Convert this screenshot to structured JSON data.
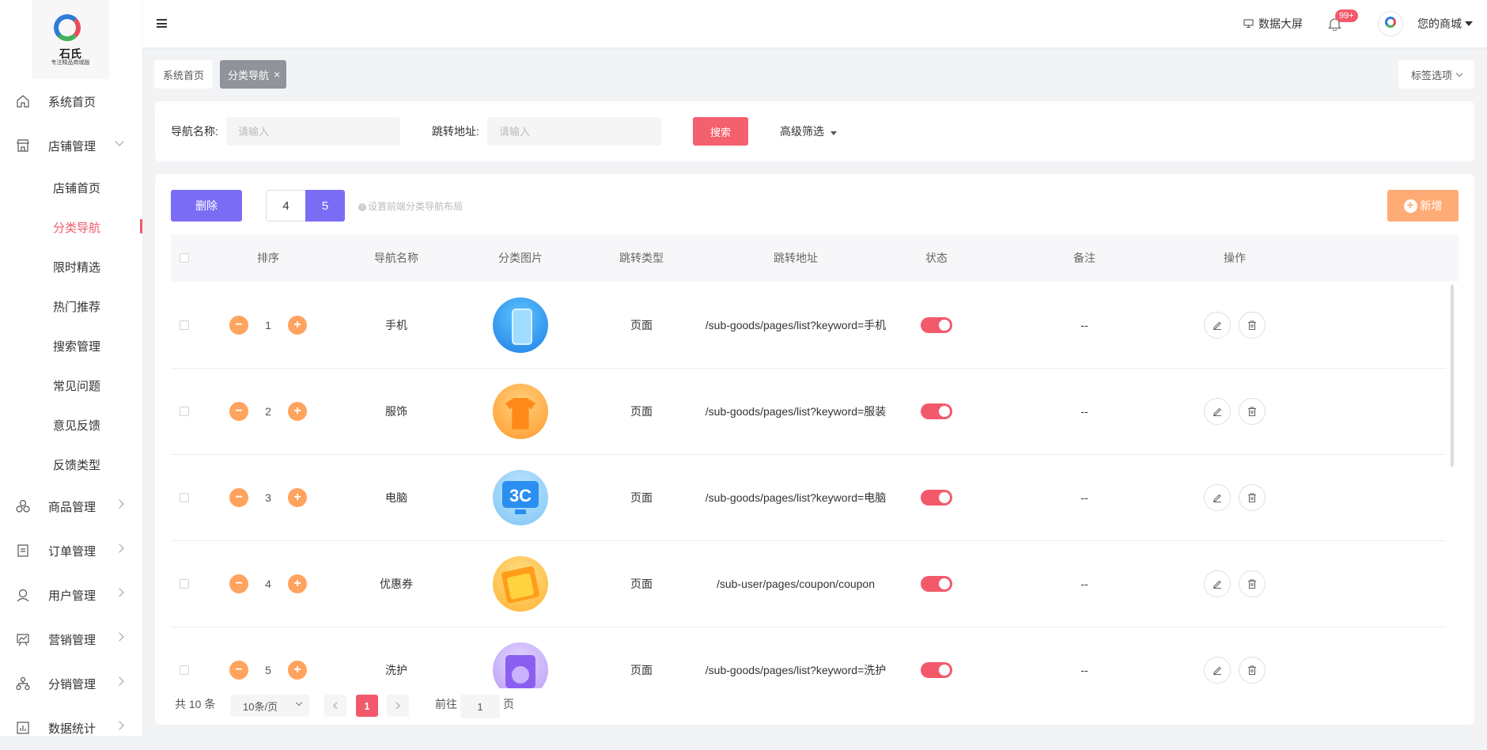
{
  "brand": {
    "name": "石氏",
    "slogan": "专注精品商城版"
  },
  "sidebar": {
    "items": [
      {
        "label": "系统首页"
      },
      {
        "label": "店铺管理"
      },
      {
        "label": "商品管理"
      },
      {
        "label": "订单管理"
      },
      {
        "label": "用户管理"
      },
      {
        "label": "营销管理"
      },
      {
        "label": "分销管理"
      },
      {
        "label": "数据统计"
      }
    ],
    "sub_items": [
      {
        "label": "店铺首页"
      },
      {
        "label": "分类导航"
      },
      {
        "label": "限时精选"
      },
      {
        "label": "热门推荐"
      },
      {
        "label": "搜索管理"
      },
      {
        "label": "常见问题"
      },
      {
        "label": "意见反馈"
      },
      {
        "label": "反馈类型"
      }
    ]
  },
  "header": {
    "data_screen": "数据大屏",
    "badge": "99+",
    "shop_name": "您的商城"
  },
  "tags": {
    "home": "系统首页",
    "active": "分类导航",
    "close": "×",
    "options": "标签选项"
  },
  "search": {
    "name_label": "导航名称:",
    "name_placeholder": "请输入",
    "url_label": "跳转地址:",
    "url_placeholder": "请输入",
    "search_btn": "搜索",
    "advanced": "高级筛选"
  },
  "toolbar": {
    "delete_btn": "删除",
    "layout_4": "4",
    "layout_5": "5",
    "hint": "设置前端分类导航布局",
    "add_btn": "新增"
  },
  "table": {
    "columns": [
      "排序",
      "导航名称",
      "分类图片",
      "跳转类型",
      "跳转地址",
      "状态",
      "备注",
      "操作"
    ],
    "rows": [
      {
        "sort": "1",
        "name": "手机",
        "type": "页面",
        "url": "/sub-goods/pages/list?keyword=手机",
        "remark": "--"
      },
      {
        "sort": "2",
        "name": "服饰",
        "type": "页面",
        "url": "/sub-goods/pages/list?keyword=服装",
        "remark": "--"
      },
      {
        "sort": "3",
        "name": "电脑",
        "type": "页面",
        "url": "/sub-goods/pages/list?keyword=电脑",
        "remark": "--"
      },
      {
        "sort": "4",
        "name": "优惠券",
        "type": "页面",
        "url": "/sub-user/pages/coupon/coupon",
        "remark": "--"
      },
      {
        "sort": "5",
        "name": "洗护",
        "type": "页面",
        "url": "/sub-goods/pages/list?keyword=洗护",
        "remark": "--"
      }
    ],
    "thumb_text_3c": "3C"
  },
  "colors": {
    "accent_red": "#f25a6b",
    "purple": "#7b6cf6",
    "orange": "#ffab75"
  },
  "pagination": {
    "total": "共 10 条",
    "page_size": "10条/页",
    "current": "1",
    "goto_label": "前往",
    "goto_value": "1",
    "page_suffix": "页"
  }
}
